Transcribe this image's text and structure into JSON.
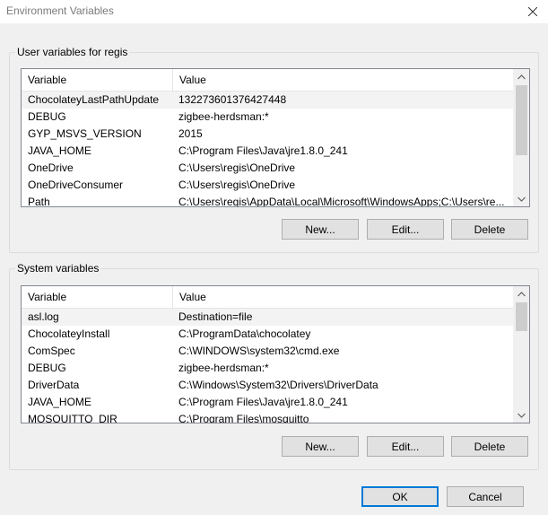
{
  "window": {
    "title": "Environment Variables"
  },
  "user_group": {
    "label": "User variables for regis",
    "columns": [
      "Variable",
      "Value"
    ],
    "rows": [
      {
        "variable": "ChocolateyLastPathUpdate",
        "value": "132273601376427448",
        "selected": true
      },
      {
        "variable": "DEBUG",
        "value": "zigbee-herdsman:*"
      },
      {
        "variable": "GYP_MSVS_VERSION",
        "value": "2015"
      },
      {
        "variable": "JAVA_HOME",
        "value": "C:\\Program Files\\Java\\jre1.8.0_241"
      },
      {
        "variable": "OneDrive",
        "value": "C:\\Users\\regis\\OneDrive"
      },
      {
        "variable": "OneDriveConsumer",
        "value": "C:\\Users\\regis\\OneDrive"
      },
      {
        "variable": "Path",
        "value": "C:\\Users\\regis\\AppData\\Local\\Microsoft\\WindowsApps;C:\\Users\\re..."
      }
    ],
    "buttons": {
      "new": "New...",
      "edit": "Edit...",
      "delete": "Delete"
    }
  },
  "system_group": {
    "label": "System variables",
    "columns": [
      "Variable",
      "Value"
    ],
    "rows": [
      {
        "variable": "asl.log",
        "value": "Destination=file",
        "selected": true
      },
      {
        "variable": "ChocolateyInstall",
        "value": "C:\\ProgramData\\chocolatey"
      },
      {
        "variable": "ComSpec",
        "value": "C:\\WINDOWS\\system32\\cmd.exe"
      },
      {
        "variable": "DEBUG",
        "value": "zigbee-herdsman:*"
      },
      {
        "variable": "DriverData",
        "value": "C:\\Windows\\System32\\Drivers\\DriverData"
      },
      {
        "variable": "JAVA_HOME",
        "value": "C:\\Program Files\\Java\\jre1.8.0_241"
      },
      {
        "variable": "MOSQUITTO_DIR",
        "value": "C:\\Program Files\\mosquitto"
      }
    ],
    "buttons": {
      "new": "New...",
      "edit": "Edit...",
      "delete": "Delete"
    }
  },
  "footer": {
    "ok": "OK",
    "cancel": "Cancel"
  },
  "icons": {
    "close": "close-icon",
    "scroll_up": "chevron-up-icon",
    "scroll_down": "chevron-down-icon"
  },
  "colors": {
    "accent": "#0078d7",
    "selection": "#f3f3f3",
    "button": "#e1e1e1"
  }
}
